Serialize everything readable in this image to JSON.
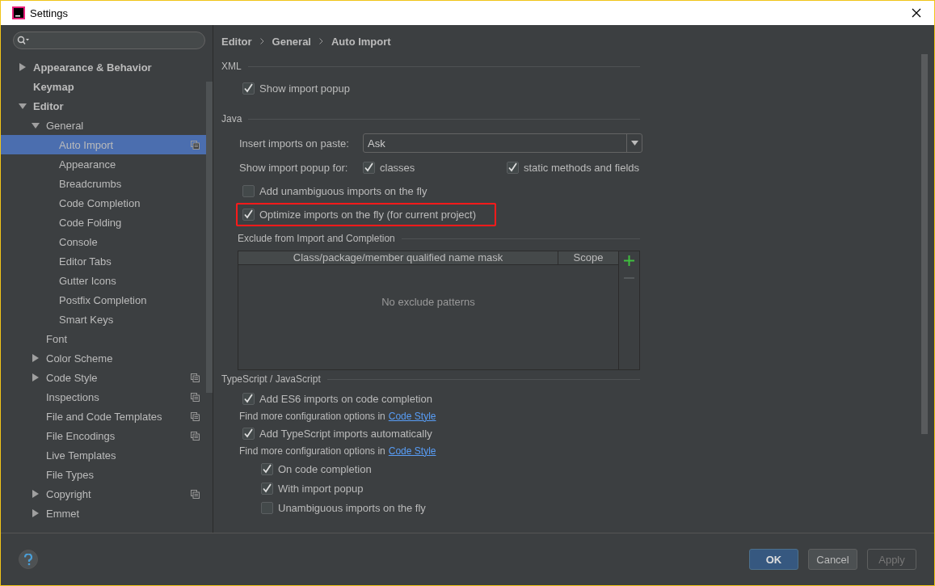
{
  "window": {
    "title": "Settings"
  },
  "sidebar": {
    "items": [
      {
        "label": "Appearance & Behavior",
        "expanded": false,
        "selected": false,
        "project_scope": false
      },
      {
        "label": "Keymap",
        "selected": false,
        "project_scope": false
      },
      {
        "label": "Editor",
        "expanded": true,
        "selected": false,
        "project_scope": false,
        "children": [
          {
            "label": "General",
            "expanded": true,
            "selected": false,
            "project_scope": false,
            "children": [
              {
                "label": "Auto Import",
                "selected": true,
                "project_scope": true
              },
              {
                "label": "Appearance",
                "selected": false,
                "project_scope": false
              },
              {
                "label": "Breadcrumbs",
                "selected": false,
                "project_scope": false
              },
              {
                "label": "Code Completion",
                "selected": false,
                "project_scope": false
              },
              {
                "label": "Code Folding",
                "selected": false,
                "project_scope": false
              },
              {
                "label": "Console",
                "selected": false,
                "project_scope": false
              },
              {
                "label": "Editor Tabs",
                "selected": false,
                "project_scope": false
              },
              {
                "label": "Gutter Icons",
                "selected": false,
                "project_scope": false
              },
              {
                "label": "Postfix Completion",
                "selected": false,
                "project_scope": false
              },
              {
                "label": "Smart Keys",
                "selected": false,
                "project_scope": false
              }
            ]
          },
          {
            "label": "Font",
            "selected": false,
            "project_scope": false
          },
          {
            "label": "Color Scheme",
            "expanded": false,
            "selected": false,
            "project_scope": false
          },
          {
            "label": "Code Style",
            "expanded": false,
            "selected": false,
            "project_scope": true
          },
          {
            "label": "Inspections",
            "selected": false,
            "project_scope": true
          },
          {
            "label": "File and Code Templates",
            "selected": false,
            "project_scope": true
          },
          {
            "label": "File Encodings",
            "selected": false,
            "project_scope": true
          },
          {
            "label": "Live Templates",
            "selected": false,
            "project_scope": false
          },
          {
            "label": "File Types",
            "selected": false,
            "project_scope": false
          },
          {
            "label": "Copyright",
            "expanded": false,
            "selected": false,
            "project_scope": true
          },
          {
            "label": "Emmet",
            "expanded": false,
            "selected": false,
            "project_scope": false
          }
        ]
      }
    ]
  },
  "breadcrumb": [
    "Editor",
    "General",
    "Auto Import"
  ],
  "xml": {
    "title": "XML",
    "options": [
      {
        "label": "Show import popup",
        "checked": true
      }
    ]
  },
  "java": {
    "title": "Java",
    "insert_imports": {
      "label": "Insert imports on paste:",
      "value": "Ask"
    },
    "popup_for": {
      "label": "Show import popup for:",
      "options": [
        {
          "label": "classes",
          "checked": true
        },
        {
          "label": "static methods and fields",
          "checked": true
        }
      ]
    },
    "options": [
      {
        "label": "Add unambiguous imports on the fly",
        "checked": false,
        "highlighted": false
      },
      {
        "label": "Optimize imports on the fly (for current project)",
        "checked": true,
        "highlighted": true
      }
    ]
  },
  "exclude": {
    "title": "Exclude from Import and Completion",
    "columns": [
      "Class/package/member qualified name mask",
      "Scope"
    ],
    "empty_text": "No exclude patterns"
  },
  "typescript": {
    "title": "TypeScript / JavaScript",
    "items": [
      {
        "kind": "checkbox",
        "label": "Add ES6 imports on code completion",
        "checked": true
      },
      {
        "kind": "hint",
        "text": "Find more configuration options in",
        "link": "Code Style"
      },
      {
        "kind": "checkbox",
        "label": "Add TypeScript imports automatically",
        "checked": true
      },
      {
        "kind": "hint",
        "text": "Find more configuration options in",
        "link": "Code Style"
      },
      {
        "kind": "subcheckbox",
        "label": "On code completion",
        "checked": true
      },
      {
        "kind": "subcheckbox",
        "label": "With import popup",
        "checked": true
      },
      {
        "kind": "subcheckbox",
        "label": "Unambiguous imports on the fly",
        "checked": false
      }
    ]
  },
  "buttons": [
    {
      "label": "OK",
      "default": true,
      "disabled": false
    },
    {
      "label": "Cancel",
      "default": false,
      "disabled": false
    },
    {
      "label": "Apply",
      "default": false,
      "disabled": true
    }
  ]
}
